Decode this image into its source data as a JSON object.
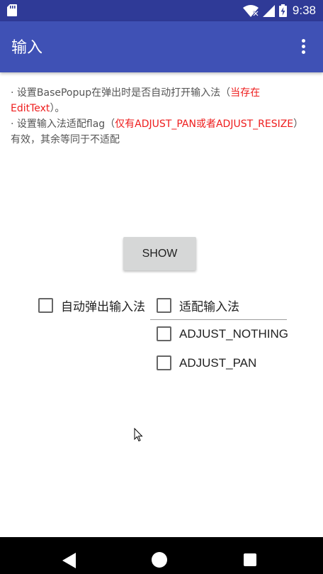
{
  "status_bar": {
    "time": "9:38",
    "icons": [
      "sd-card-icon",
      "wifi-icon",
      "signal-icon",
      "battery-charging-icon"
    ]
  },
  "app_bar": {
    "title": "输入",
    "menu_icon": "overflow-menu-icon"
  },
  "description": {
    "line1_prefix": "· 设置BasePopup在弹出时是否自动打开输入法（",
    "line1_highlight": "当存在EditText",
    "line1_suffix": "）。",
    "line2_prefix": "· 设置输入法适配flag（",
    "line2_highlight": "仅有ADJUST_PAN或者ADJUST_RESIZE",
    "line2_suffix": "）有效，其余等同于不适配",
    "highlight_color": "#ee1c1c"
  },
  "show_button": {
    "label": "SHOW"
  },
  "checkboxes": {
    "auto_popup": {
      "label": "自动弹出输入法",
      "checked": false
    },
    "adapt_input": {
      "label": "适配输入法",
      "checked": false
    },
    "adjust_nothing": {
      "label": "ADJUST_NOTHING",
      "checked": false
    },
    "adjust_pan": {
      "label": "ADJUST_PAN",
      "checked": false
    }
  },
  "nav_bar": {
    "icons": [
      "back-icon",
      "home-icon",
      "recents-icon"
    ]
  },
  "colors": {
    "status_bar": "#2f3a97",
    "app_bar": "#3f51b5",
    "accent_red": "#ee1c1c"
  }
}
